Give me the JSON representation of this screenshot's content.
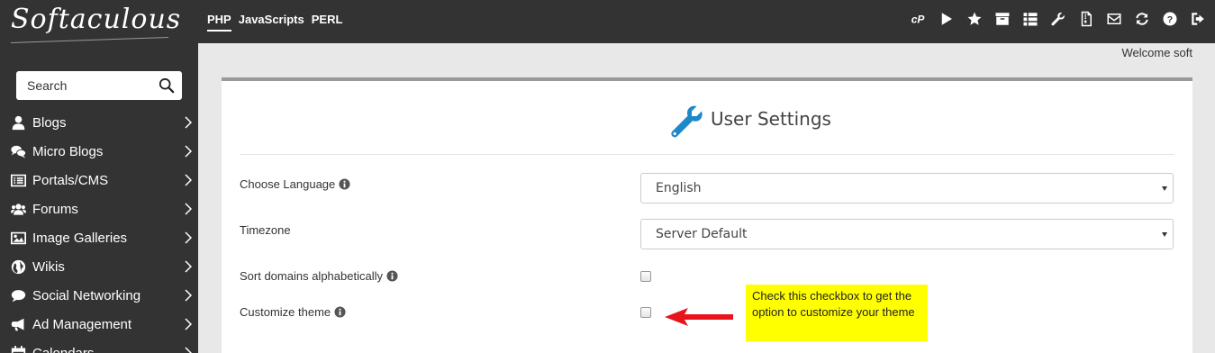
{
  "app": {
    "logo": "Softaculous",
    "tabs": [
      {
        "label": "PHP",
        "active": true
      },
      {
        "label": "JavaScripts",
        "active": false
      },
      {
        "label": "PERL",
        "active": false
      }
    ],
    "top_icons": [
      "cpanel-icon",
      "play-icon",
      "star-icon",
      "archive-icon",
      "list-icon",
      "wrench-icon",
      "file-zip-icon",
      "envelope-icon",
      "refresh-icon",
      "help-icon",
      "logout-icon"
    ]
  },
  "sidebar": {
    "search": {
      "placeholder": "Search"
    },
    "items": [
      {
        "label": "Blogs",
        "icon": "user-icon"
      },
      {
        "label": "Micro Blogs",
        "icon": "comments-icon"
      },
      {
        "label": "Portals/CMS",
        "icon": "list-alt-icon"
      },
      {
        "label": "Forums",
        "icon": "users-icon"
      },
      {
        "label": "Image Galleries",
        "icon": "image-icon"
      },
      {
        "label": "Wikis",
        "icon": "globe-icon"
      },
      {
        "label": "Social Networking",
        "icon": "chat-icon"
      },
      {
        "label": "Ad Management",
        "icon": "bullhorn-icon"
      },
      {
        "label": "Calendars",
        "icon": "calendar-icon"
      }
    ]
  },
  "header": {
    "welcome": "Welcome soft"
  },
  "settings": {
    "title": "User Settings",
    "language_label": "Choose Language",
    "language_value": "English",
    "timezone_label": "Timezone",
    "timezone_value": "Server Default",
    "sort_domains_label": "Sort domains alphabetically",
    "sort_domains_checked": false,
    "customize_theme_label": "Customize theme",
    "customize_theme_checked": false
  },
  "annotation": {
    "callout_text": "Check this checkbox to get the option to customize your theme",
    "arrow_color": "#e8141c",
    "callout_color": "#ffff00"
  },
  "colors": {
    "topbar": "#333333",
    "accent": "#1e88c8"
  }
}
